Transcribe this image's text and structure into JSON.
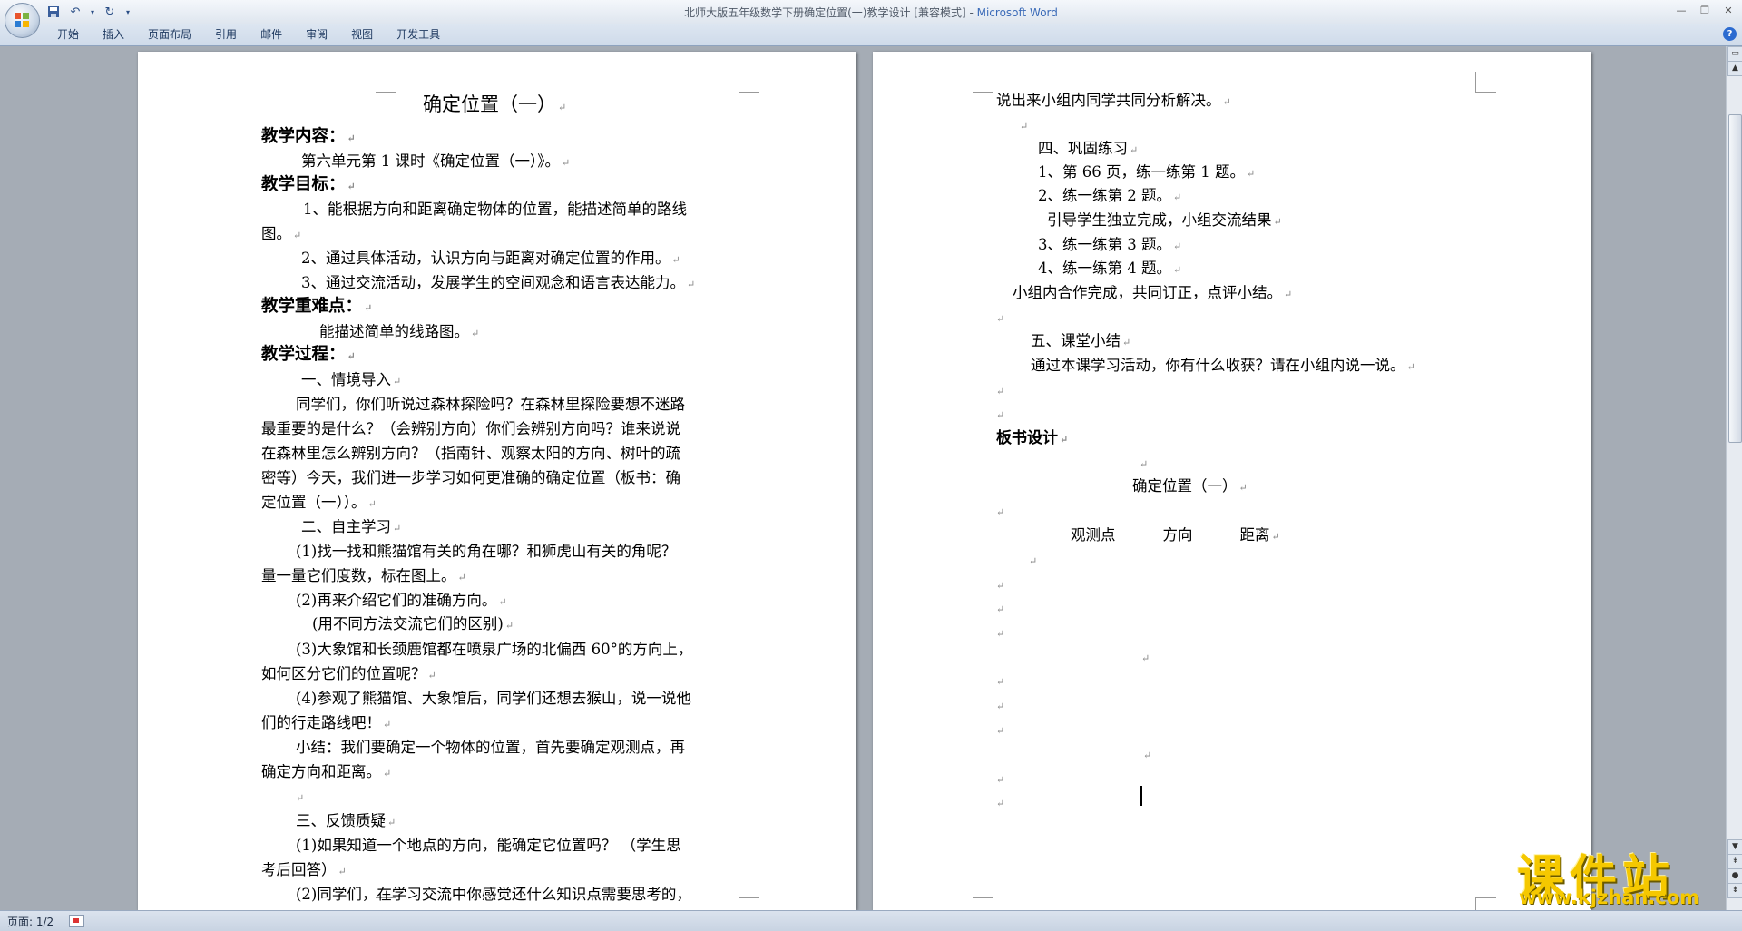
{
  "window": {
    "title": "北师大版五年级数学下册确定位置(一)教学设计 [兼容模式] - ",
    "app_name": "Microsoft Word"
  },
  "ribbon": {
    "tabs": [
      "开始",
      "插入",
      "页面布局",
      "引用",
      "邮件",
      "审阅",
      "视图",
      "开发工具"
    ]
  },
  "status": {
    "page": "页面: 1/2"
  },
  "watermark": {
    "title": "课件站",
    "url": "www.kjzhan.com"
  },
  "document": {
    "page1": {
      "title": "确定位置（一）",
      "h_content": "教学内容：",
      "content_1": "第六单元第 1 课时《确定位置（一）》。",
      "h_goals": "教学目标：",
      "goal_1a": "1、能根据方向和距离确定物体的位置，能描述简单的路线",
      "goal_1b": "图。",
      "goal_2": "2、通过具体活动，认识方向与距离对确定位置的作用。",
      "goal_3": "3、通过交流活动，发展学生的空间观念和语言表达能力。",
      "h_key": "教学重难点：",
      "key_1": "能描述简单的线路图。",
      "h_process": "教学过程：",
      "sec_1": "一、情境导入",
      "p1_l1": "同学们，你们听说过森林探险吗？在森林里探险要想不迷路",
      "p1_l2": "最重要的是什么？（会辨别方向）你们会辨别方向吗？谁来说说",
      "p1_l3": "在森林里怎么辨别方向？（指南针、观察太阳的方向、树叶的疏",
      "p1_l4": "密等）今天，我们进一步学习如何更准确的确定位置（板书：确",
      "p1_l5": "定位置（一））。",
      "sec_2": "二、自主学习",
      "q1_l1": "(1)找一找和熊猫馆有关的角在哪？和狮虎山有关的角呢？",
      "q1_l2": "量一量它们度数，标在图上。",
      "q2": "(2)再来介绍它们的准确方向。",
      "q2_note": "(用不同方法交流它们的区别)",
      "q3_l1": "(3)大象馆和长颈鹿馆都在喷泉广场的北偏西 60°的方向上，",
      "q3_l2": "如何区分它们的位置呢？",
      "q4_l1": "(4)参观了熊猫馆、大象馆后，同学们还想去猴山，说一说他",
      "q4_l2": "们的行走路线吧！",
      "sum_l1": "小结：我们要确定一个物体的位置，首先要确定观测点，再",
      "sum_l2": "确定方向和距离。",
      "sec_3": "三、反馈质疑",
      "f1_l1": "(1)如果知道一个地点的方向，能确定它位置吗？ （学生思",
      "f1_l2": "考后回答）",
      "f2_l1": "(2)同学们，在学习交流中你感觉还什么知识点需要思考的，"
    },
    "page2": {
      "l1": "说出来小组内同学共同分析解决。",
      "sec_4": "四、巩固练习",
      "e1": "1、第 66 页，练一练第 1 题。",
      "e2": "2、练一练第 2 题。",
      "e2_note": "引导学生独立完成，小组交流结果",
      "e3": "3、练一练第 3 题。",
      "e4": "4、练一练第 4 题。",
      "e_note": "小组内合作完成，共同订正，点评小结。",
      "sec_5": "五、课堂小结",
      "s5_l1": "通过本课学习活动，你有什么收获？请在小组内说一说。",
      "h_board": "板书设计",
      "board_title": "确定位置（一）",
      "board_col1": "观测点",
      "board_col2": "方向",
      "board_col3": "距离"
    }
  }
}
